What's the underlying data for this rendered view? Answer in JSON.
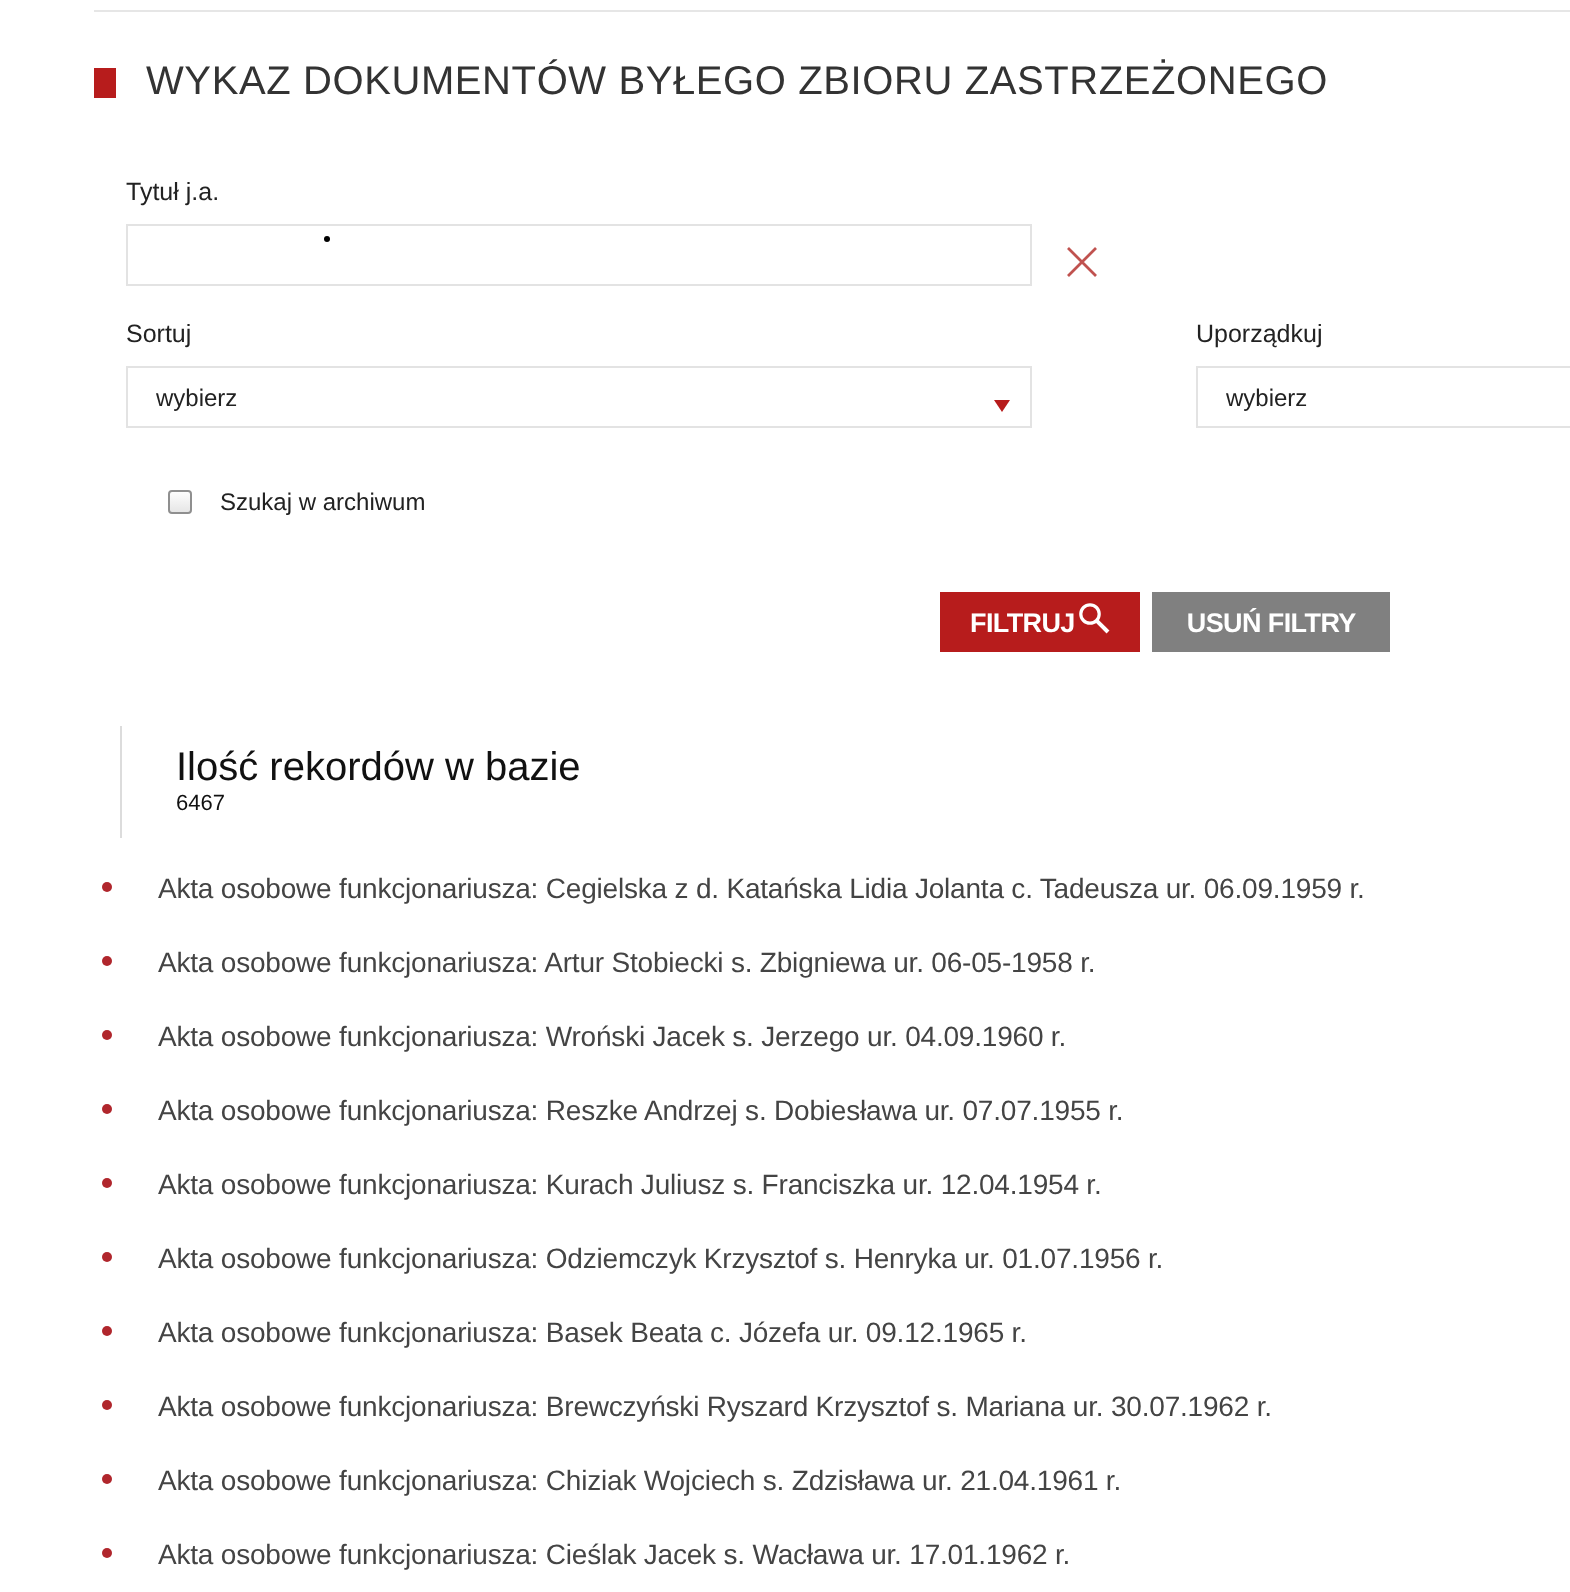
{
  "header": {
    "title": "WYKAZ DOKUMENTÓW BYŁEGO ZBIORU ZASTRZEŻONEGO"
  },
  "filters": {
    "title_field": {
      "label": "Tytuł j.a."
    },
    "sort": {
      "label": "Sortuj",
      "value": "wybierz"
    },
    "order": {
      "label": "Uporządkuj",
      "value": "wybierz"
    },
    "archive": {
      "label": "Szukaj w archiwum",
      "checked": false
    }
  },
  "buttons": [
    {
      "label": "FILTRUJ",
      "kind": "primary"
    },
    {
      "label": "USUŃ FILTRY",
      "kind": "secondary"
    }
  ],
  "records": {
    "heading": "Ilość rekordów w bazie",
    "count": "6467"
  },
  "documents": [
    "Akta osobowe funkcjonariusza: Cegielska z d. Katańska Lidia Jolanta c. Tadeusza ur. 06.09.1959 r.",
    "Akta osobowe funkcjonariusza: Artur Stobiecki s. Zbigniewa ur. 06-05-1958 r.",
    "Akta osobowe funkcjonariusza: Wroński Jacek s. Jerzego ur. 04.09.1960 r.",
    "Akta osobowe funkcjonariusza: Reszke Andrzej s. Dobiesława ur. 07.07.1955 r.",
    "Akta osobowe funkcjonariusza: Kurach Juliusz s. Franciszka ur. 12.04.1954 r.",
    "Akta osobowe funkcjonariusza: Odziemczyk Krzysztof s. Henryka ur. 01.07.1956 r.",
    "Akta osobowe funkcjonariusza: Basek Beata c. Józefa ur. 09.12.1965 r.",
    "Akta osobowe funkcjonariusza: Brewczyński Ryszard Krzysztof s. Mariana ur. 30.07.1962 r.",
    "Akta osobowe funkcjonariusza: Chiziak Wojciech s. Zdzisława ur. 21.04.1961 r.",
    "Akta osobowe funkcjonariusza: Cieślak Jacek s. Wacława ur. 17.01.1962 r."
  ]
}
